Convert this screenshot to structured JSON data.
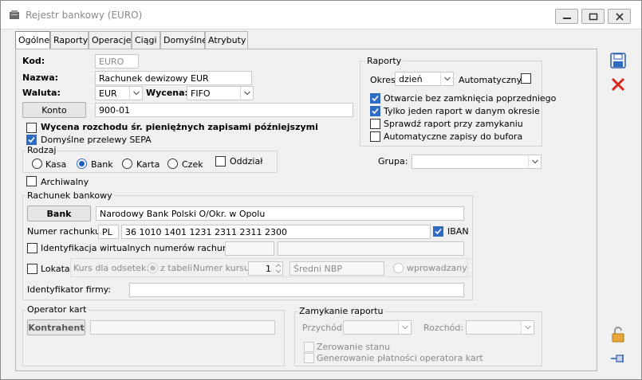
{
  "window": {
    "title": "Rejestr bankowy (EURO)"
  },
  "tabs": [
    "Ogólne",
    "Raporty",
    "Operacje",
    "Ciągi",
    "Domyślne",
    "Atrybuty"
  ],
  "general": {
    "kod_label": "Kod:",
    "kod_value": "EURO",
    "nazwa_label": "Nazwa:",
    "nazwa_value": "Rachunek dewizowy EUR",
    "waluta_label": "Waluta:",
    "waluta_value": "EUR",
    "wycena_label": "Wycena:",
    "wycena_value": "FIFO",
    "konto_button": "Konto",
    "konto_value": "900-01",
    "wycena_rozchodu": "Wycena rozchodu śr. pieniężnych zapisami późniejszymi",
    "domyslne_sepa": "Domyślne przelewy SEPA",
    "archiwalny": "Archiwalny"
  },
  "rodzaj": {
    "title": "Rodzaj",
    "options": [
      "Kasa",
      "Bank",
      "Karta",
      "Czek"
    ],
    "selected": "Bank",
    "oddzial": "Oddział"
  },
  "raporty": {
    "title": "Raporty",
    "okres_label": "Okres:",
    "okres_value": "dzień",
    "automatyczny": "Automatyczny",
    "otwarcie": "Otwarcie bez zamknięcia poprzedniego",
    "tylko_jeden": "Tylko jeden raport w danym okresie",
    "sprawdz": "Sprawdź raport przy zamykaniu",
    "auto_zapisy": "Automatyczne zapisy do bufora"
  },
  "grupa_label": "Grupa:",
  "rachunek": {
    "title": "Rachunek bankowy",
    "bank_button": "Bank",
    "bank_name": "Narodowy Bank Polski O/Okr. w Opolu",
    "numer_label": "Numer rachunku:",
    "country": "PL",
    "number": "36 1010 1401 1231 2311 2311 2300",
    "iban": "IBAN",
    "identyfikacja": "Identyfikacja wirtualnych numerów rachunków",
    "lokata": "Lokata",
    "kurs_label": "Kurs dla odsetek:",
    "z_tabeli": "z tabeli",
    "numer_kursu_label": "Numer kursu:",
    "numer_kursu_value": "1",
    "sredni_nbp": "Średni NBP",
    "wprowadzany": "wprowadzany",
    "identyfikator_label": "Identyfikator firmy:"
  },
  "operator": {
    "title": "Operator kart",
    "kontrahent_button": "Kontrahent"
  },
  "zamykanie": {
    "title": "Zamykanie raportu",
    "przychod_label": "Przychód:",
    "rozchod_label": "Rozchód:",
    "zerowanie": "Zerowanie stanu",
    "generowanie": "Generowanie płatności operatora kart"
  },
  "colors": {
    "accent": "#2e6bc2",
    "delete": "#d9251c"
  }
}
